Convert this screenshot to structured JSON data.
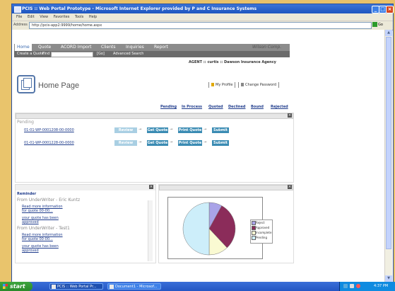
{
  "window": {
    "title": "PCIS :: Web Portal Prototype - Microsoft Internet Explorer provided by P and C Insurance Systems",
    "menu": [
      "File",
      "Edit",
      "View",
      "Favorites",
      "Tools",
      "Help"
    ],
    "address_label": "Address",
    "address_url": "http://pcis-app2:9999/home/home.aspx",
    "go_label": "Go"
  },
  "app": {
    "nav": [
      "Home",
      "Quote",
      "ACORD Import",
      "Clients",
      "Inquiries",
      "Report"
    ],
    "subnav": {
      "create": "Create a Quote",
      "find": "Find",
      "go": "[Go]",
      "advanced": "Advanced Search"
    },
    "logo": "Wilson Comp.",
    "agent_line": "AGENT :: curtis :: Dawson Insurance Agency",
    "page_title": "Home Page",
    "my_profile": "My Profile",
    "change_password": "Change Password",
    "tabs": [
      "Pending",
      "In Process",
      "Quoted",
      "Declined",
      "Bound",
      "Rejected"
    ]
  },
  "pending": {
    "label": "Pending",
    "rows": [
      {
        "quote": "01-01-WP-0001208-00-0000",
        "steps": [
          "Review App",
          "Get Quote",
          "Print Quote",
          "Submit"
        ]
      },
      {
        "quote": "01-01-WP-0001228-00-0000",
        "steps": [
          "Review App",
          "Get Quote",
          "Print Quote",
          "Submit"
        ]
      }
    ]
  },
  "reminder": {
    "title": "Reminder",
    "items": [
      {
        "from": "From UnderWriter - Eric Kuntz",
        "links": [
          "Read more information for quote 00-00...",
          "your quote has been approved"
        ]
      },
      {
        "from": "From UnderWriter - Test1",
        "links": [
          "Read more information for quote 00-00...",
          "your quote has been approved"
        ]
      }
    ]
  },
  "chart_data": {
    "type": "pie",
    "categories": [
      "Reject",
      "Approved",
      "Incomplete",
      "Pending"
    ],
    "values": [
      8,
      30,
      12,
      50
    ],
    "colors": [
      "#a9a3e8",
      "#8b2c5a",
      "#fafad2",
      "#cdeefa"
    ],
    "legend": "right"
  },
  "taskbar": {
    "start": "start",
    "tasks": [
      "PCIS :: Web Portal Pr...",
      "Document1 - Microsof..."
    ],
    "clock": "4:37 PM"
  }
}
